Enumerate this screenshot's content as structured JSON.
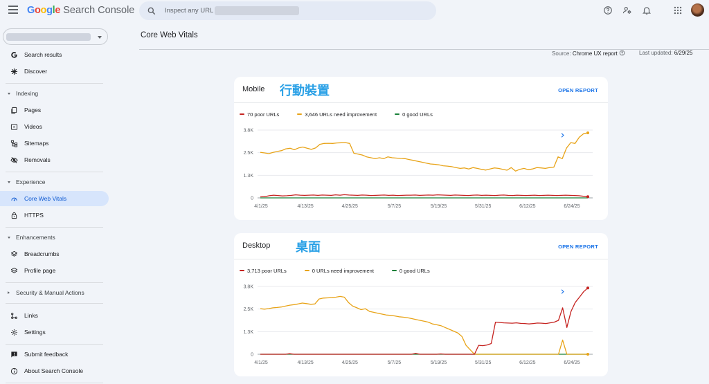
{
  "header": {
    "logo_google": "Google",
    "logo_product": "Search Console",
    "search_placeholder": "Inspect any URL"
  },
  "sidebar": {
    "items": [
      {
        "key": "search-results",
        "label": "Search results",
        "icon": "google-g-icon"
      },
      {
        "key": "discover",
        "label": "Discover",
        "icon": "asterisk-icon"
      },
      {
        "key": "indexing-section",
        "label": "Indexing",
        "section": true,
        "expanded": true
      },
      {
        "key": "pages",
        "label": "Pages",
        "icon": "pages-icon"
      },
      {
        "key": "videos",
        "label": "Videos",
        "icon": "video-icon"
      },
      {
        "key": "sitemaps",
        "label": "Sitemaps",
        "icon": "sitemap-icon"
      },
      {
        "key": "removals",
        "label": "Removals",
        "icon": "eye-off-icon"
      },
      {
        "key": "experience-section",
        "label": "Experience",
        "section": true,
        "expanded": true
      },
      {
        "key": "core-web-vitals",
        "label": "Core Web Vitals",
        "icon": "gauge-icon",
        "active": true
      },
      {
        "key": "https",
        "label": "HTTPS",
        "icon": "lock-icon"
      },
      {
        "key": "enhancements-section",
        "label": "Enhancements",
        "section": true,
        "expanded": true
      },
      {
        "key": "breadcrumbs",
        "label": "Breadcrumbs",
        "icon": "layers-icon"
      },
      {
        "key": "profile-page",
        "label": "Profile page",
        "icon": "layers-icon"
      },
      {
        "key": "security-section",
        "label": "Security & Manual Actions",
        "section": true,
        "expanded": false
      },
      {
        "key": "links",
        "label": "Links",
        "icon": "links-icon"
      },
      {
        "key": "settings",
        "label": "Settings",
        "icon": "gear-icon"
      },
      {
        "key": "submit-feedback",
        "label": "Submit feedback",
        "icon": "feedback-icon"
      },
      {
        "key": "about",
        "label": "About Search Console",
        "icon": "info-icon"
      }
    ]
  },
  "page": {
    "title": "Core Web Vitals",
    "source_label": "Source:",
    "source_value": "Chrome UX report",
    "updated_label": "Last updated:",
    "updated_value": "6/29/25"
  },
  "colors": {
    "poor": "#c5221f",
    "needs_improvement": "#e8a317",
    "good": "#188038",
    "accent": "#1a73e8",
    "annotation": "#29a0e6"
  },
  "cards": [
    {
      "title": "Mobile",
      "annotation": "行動裝置",
      "open_label": "OPEN REPORT",
      "legend": [
        "70 poor URLs",
        "3,646 URLs need improvement",
        "0 good URLs"
      ]
    },
    {
      "title": "Desktop",
      "annotation": "桌面",
      "open_label": "OPEN REPORT",
      "legend": [
        "3,713 poor URLs",
        "0 URLs need improvement",
        "0 good URLs"
      ]
    }
  ],
  "chart_data": [
    {
      "type": "line",
      "title": "Mobile",
      "x_ticks": [
        "4/1/25",
        "4/13/25",
        "4/25/25",
        "5/7/25",
        "5/19/25",
        "5/31/25",
        "6/12/25",
        "6/24/25"
      ],
      "y_ticks": [
        "0",
        "1.3K",
        "2.5K",
        "3.8K"
      ],
      "ylim": [
        0,
        3800
      ],
      "grid": true,
      "legend_position": "top-left",
      "series": [
        {
          "name": "70 poor URLs",
          "color": "#c5221f",
          "values": [
            60,
            70,
            120,
            150,
            130,
            110,
            120,
            140,
            170,
            150,
            140,
            150,
            160,
            140,
            160,
            150,
            140,
            170,
            150,
            180,
            160,
            150,
            140,
            160,
            150,
            130,
            140,
            150,
            160,
            140,
            150,
            130,
            140,
            150,
            150,
            160,
            140,
            150,
            160,
            150,
            170,
            160,
            150,
            140,
            160,
            150,
            140,
            130,
            150,
            160,
            140,
            150,
            140,
            130,
            150,
            160,
            140,
            130,
            150,
            140,
            130,
            140,
            150,
            130,
            140,
            150,
            140,
            130,
            140,
            150,
            140,
            130,
            120,
            90,
            70
          ]
        },
        {
          "name": "3,646 URLs need improvement",
          "color": "#e8a317",
          "values": [
            2550,
            2520,
            2480,
            2550,
            2600,
            2650,
            2750,
            2780,
            2700,
            2800,
            2850,
            2780,
            2720,
            2800,
            3000,
            3050,
            3060,
            3050,
            3080,
            3090,
            3100,
            3050,
            2500,
            2450,
            2400,
            2300,
            2250,
            2200,
            2250,
            2200,
            2300,
            2250,
            2230,
            2210,
            2200,
            2150,
            2100,
            2050,
            2000,
            1950,
            1900,
            1880,
            1850,
            1800,
            1780,
            1750,
            1700,
            1650,
            1680,
            1620,
            1700,
            1650,
            1600,
            1560,
            1620,
            1680,
            1650,
            1600,
            1550,
            1700,
            1500,
            1600,
            1650,
            1580,
            1620,
            1700,
            1680,
            1650,
            1700,
            1720,
            2300,
            2200,
            2800,
            3100,
            3050,
            3400,
            3600,
            3646
          ]
        },
        {
          "name": "0 good URLs",
          "color": "#188038",
          "values": [
            0,
            0
          ]
        }
      ]
    },
    {
      "type": "line",
      "title": "Desktop",
      "x_ticks": [
        "4/1/25",
        "4/13/25",
        "4/25/25",
        "5/7/25",
        "5/19/25",
        "5/31/25",
        "6/12/25",
        "6/24/25"
      ],
      "y_ticks": [
        "0",
        "1.3K",
        "2.5K",
        "3.8K"
      ],
      "ylim": [
        0,
        3800
      ],
      "grid": true,
      "legend_position": "top-left",
      "series": [
        {
          "name": "3,713 poor URLs",
          "color": "#c5221f",
          "values": [
            0,
            0,
            0,
            0,
            0,
            0,
            0,
            30,
            0,
            0,
            0,
            0,
            0,
            0,
            0,
            0,
            0,
            0,
            0,
            0,
            0,
            0,
            0,
            0,
            0,
            0,
            0,
            0,
            0,
            0,
            0,
            0,
            0,
            0,
            0,
            0,
            0,
            50,
            0,
            0,
            0,
            0,
            0,
            20,
            0,
            0,
            0,
            0,
            0,
            0,
            0,
            0,
            500,
            480,
            520,
            600,
            1800,
            1780,
            1760,
            1750,
            1740,
            1760,
            1730,
            1720,
            1700,
            1720,
            1750,
            1740,
            1720,
            1760,
            1800,
            1900,
            2600,
            1500,
            2400,
            2900,
            3200,
            3500,
            3713
          ]
        },
        {
          "name": "0 URLs need improvement",
          "color": "#e8a317",
          "values": [
            2550,
            2530,
            2560,
            2600,
            2620,
            2650,
            2700,
            2750,
            2780,
            2820,
            2870,
            2840,
            2800,
            2820,
            3100,
            3150,
            3160,
            3170,
            3200,
            3240,
            3200,
            2900,
            2700,
            2600,
            2500,
            2550,
            2400,
            2350,
            2300,
            2250,
            2200,
            2180,
            2150,
            2100,
            2080,
            2050,
            2000,
            1950,
            1900,
            1850,
            1800,
            1700,
            1650,
            1600,
            1500,
            1400,
            1300,
            1200,
            1000,
            500,
            250,
            0,
            0,
            0,
            0,
            0,
            0,
            0,
            0,
            0,
            0,
            0,
            0,
            0,
            0,
            0,
            0,
            0,
            0,
            0,
            0,
            0,
            800,
            0,
            0,
            0,
            0,
            0,
            0
          ]
        },
        {
          "name": "0 good URLs",
          "color": "#188038",
          "values": [
            0,
            0
          ]
        }
      ]
    }
  ]
}
